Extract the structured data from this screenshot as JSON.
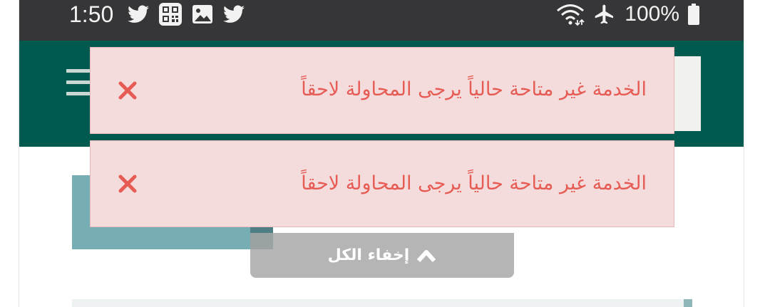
{
  "status_bar": {
    "time": "1:50",
    "battery_percent": "100%",
    "left_icons": [
      "twitter-icon",
      "qr-code-icon",
      "image-icon",
      "twitter-icon"
    ],
    "right_icons": [
      "wifi-icon",
      "airplane-icon",
      "battery-icon"
    ]
  },
  "toasts": [
    {
      "message": "الخدمة غير متاحة حالياً يرجى المحاولة لاحقاً",
      "close_icon": "close-icon"
    },
    {
      "message": "الخدمة غير متاحة حالياً يرجى المحاولة لاحقاً",
      "close_icon": "close-icon"
    }
  ],
  "hide_all": {
    "label": "إخفاء الكل",
    "icon": "chevron-up-icon"
  },
  "colors": {
    "status_bar": "#363638",
    "header": "#005a50",
    "toast_background": "#f4dcdd",
    "toast_text": "#e65c54",
    "card": "#77aeb3",
    "hide_all_button": "#a8a8a8"
  }
}
